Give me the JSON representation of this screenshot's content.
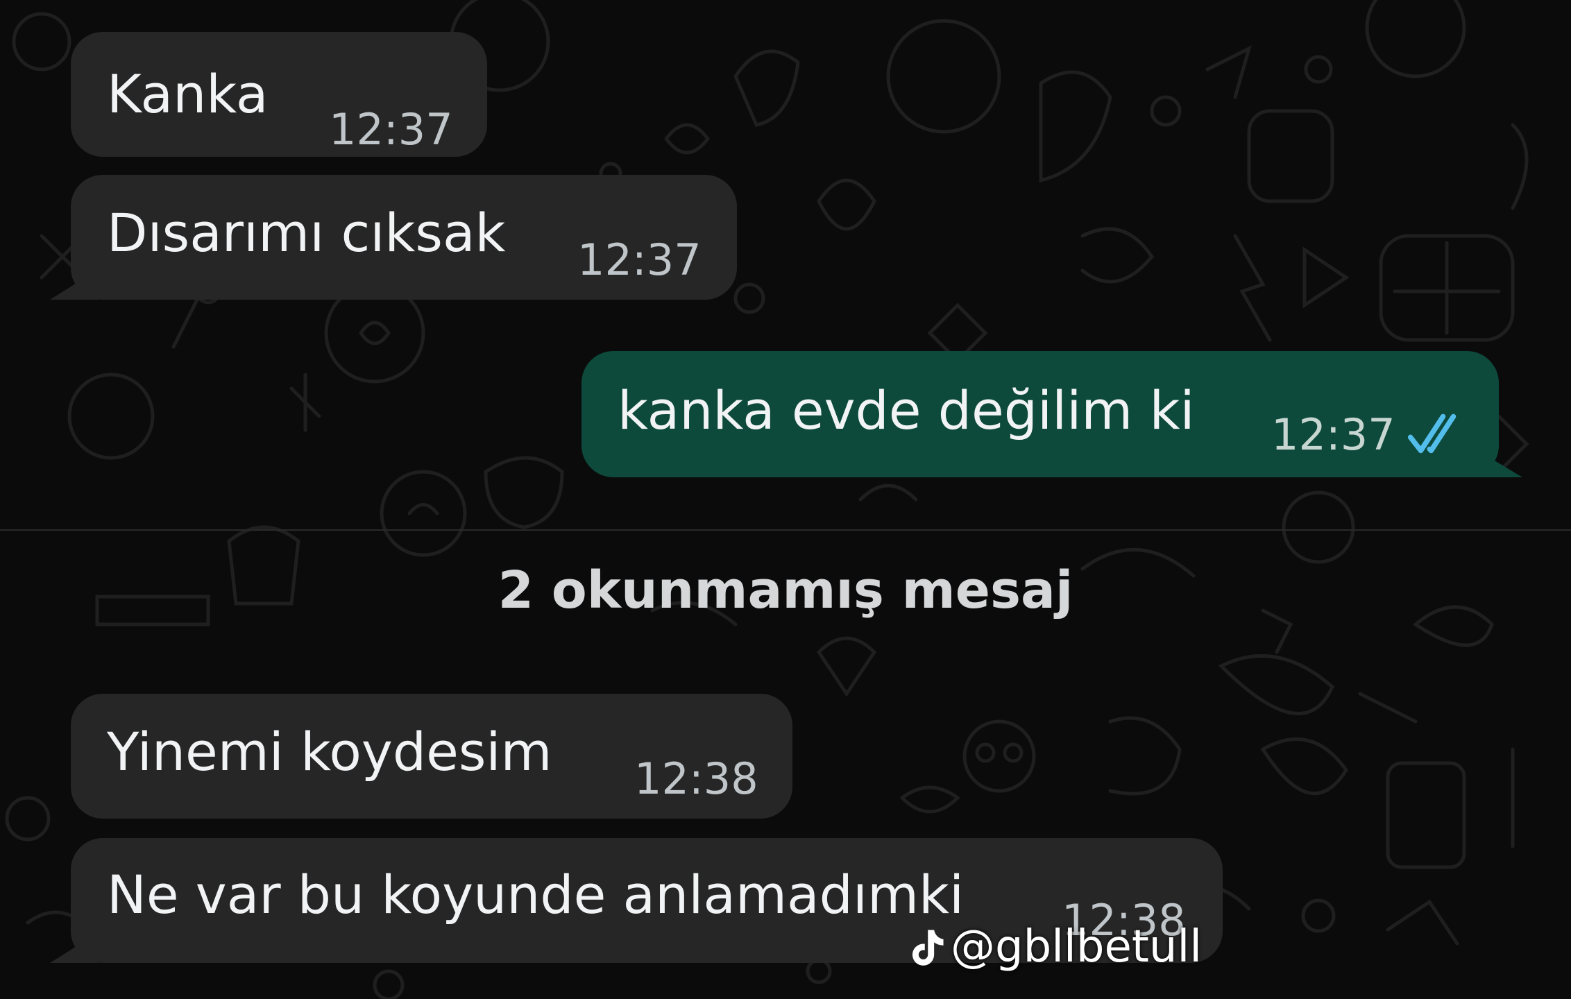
{
  "chat": {
    "messages": [
      {
        "direction": "incoming",
        "text": "Kanka",
        "time": "12:37"
      },
      {
        "direction": "incoming",
        "text": "Dısarımı cıksak",
        "time": "12:37"
      },
      {
        "direction": "outgoing",
        "text": "kanka evde değilim ki",
        "time": "12:37",
        "status_icon": "double-check-read-icon"
      },
      {
        "direction": "incoming",
        "text": "Yinemi koydesim",
        "time": "12:38"
      },
      {
        "direction": "incoming",
        "text": "Ne var bu koyunde anlamadımki",
        "time": "12:38"
      }
    ],
    "unread_divider": "2 okunmamış mesaj"
  },
  "watermark": {
    "icon": "tiktok-logo-icon",
    "handle": "@gbllbetull"
  },
  "colors": {
    "background": "#0b0b0b",
    "incoming_bubble": "#262626",
    "outgoing_bubble": "#0d4a3b",
    "read_ticks": "#53bdeb"
  }
}
